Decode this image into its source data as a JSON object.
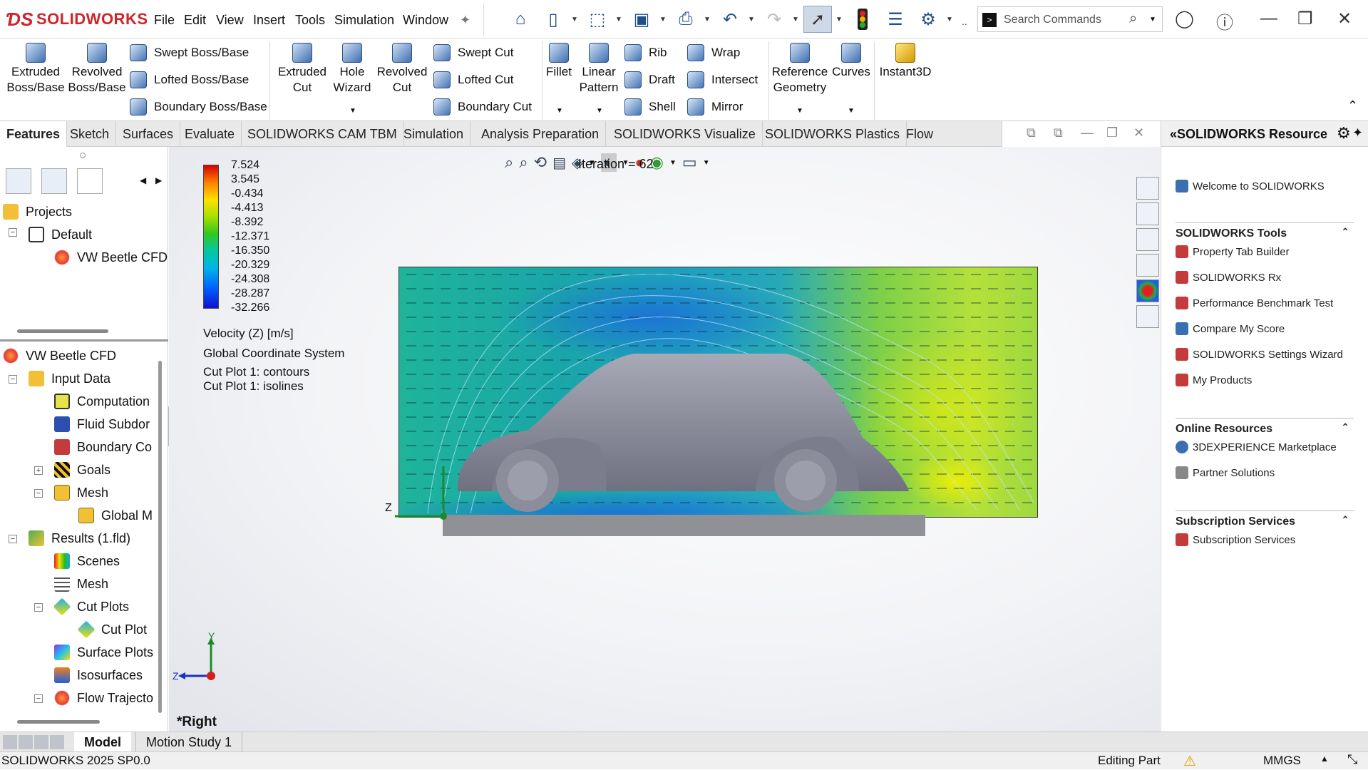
{
  "app": {
    "brand": "SOLIDWORKS",
    "menu": [
      "File",
      "Edit",
      "View",
      "Insert",
      "Tools",
      "Simulation",
      "Window"
    ],
    "search_placeholder": "Search Commands",
    "accent": "#d0242b"
  },
  "ribbon": {
    "big": [
      {
        "label": "Extruded\nBoss/Base"
      },
      {
        "label": "Revolved\nBoss/Base"
      },
      {
        "label": "Extruded\nCut"
      },
      {
        "label": "Hole\nWizard"
      },
      {
        "label": "Revolved\nCut"
      },
      {
        "label": "Fillet"
      },
      {
        "label": "Linear\nPattern"
      },
      {
        "label": "Reference\nGeometry"
      },
      {
        "label": "Curves"
      },
      {
        "label": "Instant3D"
      }
    ],
    "small": [
      "Swept Boss/Base",
      "Lofted Boss/Base",
      "Boundary Boss/Base",
      "Swept Cut",
      "Lofted Cut",
      "Boundary Cut",
      "Rib",
      "Draft",
      "Shell",
      "Wrap",
      "Intersect",
      "Mirror"
    ]
  },
  "tabs": [
    "Features",
    "Sketch",
    "Surfaces",
    "Evaluate",
    "SOLIDWORKS CAM TBM",
    "Simulation",
    "Analysis Preparation",
    "SOLIDWORKS Visualize",
    "SOLIDWORKS Plastics",
    "Flow Simulation"
  ],
  "tree_top": {
    "projects": "Projects",
    "default": "Default",
    "project_item": "VW Beetle CFD"
  },
  "tree": {
    "root": "VW Beetle CFD",
    "input_data": "Input Data",
    "computation": "Computation",
    "fluid": "Fluid Subdor",
    "boundary": "Boundary Co",
    "goals": "Goals",
    "mesh": "Mesh",
    "global_mesh": "Global M",
    "results": "Results (1.fld)",
    "scenes": "Scenes",
    "res_mesh": "Mesh",
    "cut_plots": "Cut Plots",
    "cut_plot": "Cut Plot",
    "surface_plots": "Surface Plots",
    "isosurfaces": "Isosurfaces",
    "flow_traj": "Flow Trajecto"
  },
  "viewport": {
    "iteration": "Iteration = 62",
    "legend_values": [
      "7.524",
      "3.545",
      "-0.434",
      "-4.413",
      "-8.392",
      "-12.371",
      "-16.350",
      "-20.329",
      "-24.308",
      "-28.287",
      "-32.266"
    ],
    "label1": "Velocity (Z) [m/s]",
    "label2": "Global Coordinate System",
    "label3": "Cut Plot 1: contours",
    "label4": "Cut Plot 1: isolines",
    "view_name": "*Right",
    "axis_y": "Y",
    "axis_z": "Z",
    "axis_z2": "Z"
  },
  "resources": {
    "title": "SOLIDWORKS Resource",
    "welcome": "Welcome to SOLIDWORKS",
    "tools_header": "SOLIDWORKS Tools",
    "tools": [
      "Property Tab Builder",
      "SOLIDWORKS Rx",
      "Performance Benchmark Test",
      "Compare My Score",
      "SOLIDWORKS Settings Wizard",
      "My Products"
    ],
    "online_header": "Online Resources",
    "online": [
      "3DEXPERIENCE Marketplace",
      "Partner Solutions"
    ],
    "sub_header": "Subscription Services",
    "sub": [
      "Subscription Services"
    ]
  },
  "bottom_tabs": [
    "Model",
    "Motion Study 1"
  ],
  "status": {
    "version": "SOLIDWORKS 2025 SP0.0",
    "mode": "Editing Part",
    "units": "MMGS"
  }
}
